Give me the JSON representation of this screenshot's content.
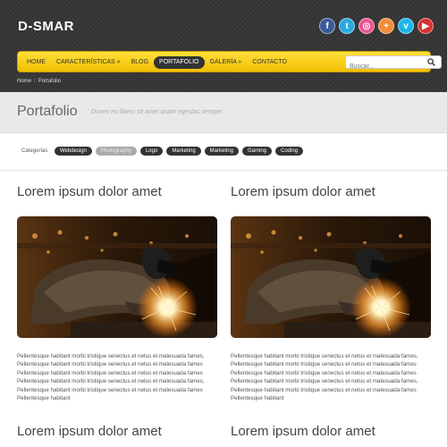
{
  "header": {
    "logo": "D-SMAR",
    "social": [
      {
        "icon": "facebook-icon",
        "glyph": "f",
        "color": "#3b5998"
      },
      {
        "icon": "twitter-icon",
        "glyph": "t",
        "color": "#29a9e1"
      },
      {
        "icon": "dribbble-icon",
        "glyph": "◎",
        "color": "#e8548f"
      },
      {
        "icon": "plus-icon",
        "glyph": "+",
        "color": "#f28c38"
      },
      {
        "icon": "vimeo-icon",
        "glyph": "v",
        "color": "#1ab7ea"
      },
      {
        "icon": "youtube-icon",
        "glyph": "▶",
        "color": "#d9312f"
      }
    ]
  },
  "nav": {
    "items": [
      "HOME",
      "CARACTERÍSTICAS »",
      "BLOG",
      "PORTAFOLIO",
      "GALERÍA »",
      "CONTACTO"
    ],
    "active": "PORTAFOLIO",
    "search_placeholder": "Buscar..."
  },
  "breadcrumb": {
    "home": "Home",
    "current": "Portafolio"
  },
  "title": {
    "main": "Portafolio",
    "subtitle": "Donec eu libero sit amet quam egestas semper."
  },
  "filters": {
    "label": "Categorías",
    "items": [
      "Webdesign",
      "Photography",
      "Logo",
      "Marketing",
      "Marketing",
      "Gaming",
      "Coding"
    ],
    "active": "Photography"
  },
  "items": [
    {
      "title": "Lorem ipsum dolor amet",
      "text": "Pellentesque habitant morbi tristique senectus et netus et malesuada fames, Pellentesque habitant morbi tristique senectus et netus et malesuada fames Pellentesque habitant morbi tristique senectus et netus et malesuada fames Pellentesque habitant morbi tristique senectus et netus et malesuada fames, Pellentesque habitant morbi tristique senectus et netus et malesuada fames Pellentesque habitant"
    },
    {
      "title": "Lorem ipsum dolor amet",
      "text": "Pellentesque habitant morbi tristique senectus et netus et malesuada fames, Pellentesque habitant morbi tristique senectus et netus et malesuada fames Pellentesque habitant morbi tristique senectus et netus et malesuada fames Pellentesque habitant morbi tristique senectus et netus et malesuada fames, Pellentesque habitant morbi tristique senectus et netus et malesuada fames Pellentesque habitant"
    },
    {
      "title": "Lorem ipsum dolor amet"
    },
    {
      "title": "Lorem ipsum dolor amet"
    }
  ]
}
